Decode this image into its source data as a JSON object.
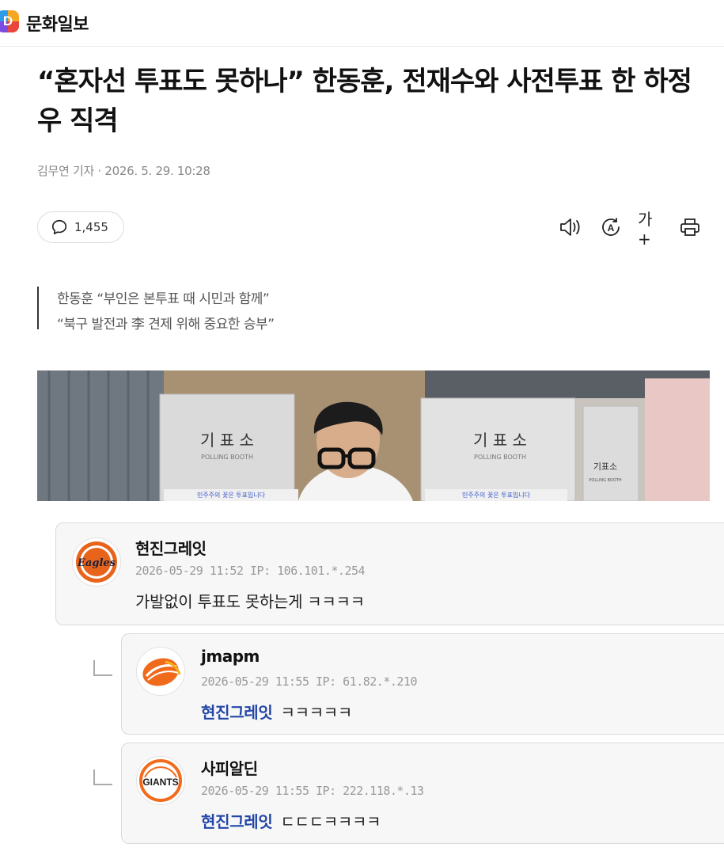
{
  "header": {
    "logo_letter": "D",
    "brand": "문화일보"
  },
  "article": {
    "title": "“혼자선 투표도 못하나” 한동훈, 전재수와 사전투표 한 하정우 직격",
    "byline": "김무연 기자 · 2026. 5. 29. 10:28",
    "comment_count": "1,455",
    "tools": {
      "font_size_label": "가+"
    },
    "summary": [
      "한동훈 “부인은 본투표 때 시민과 함께”",
      "“북구 발전과 李 견제 위해 중요한 승부”"
    ],
    "photo": {
      "booth_left": "기 표 소",
      "booth_left_sub": "POLLING BOOTH",
      "booth_right": "기 표 소",
      "booth_right_sub": "POLLING BOOTH",
      "booth_far": "기표소",
      "booth_far_sub": "POLLING BOOTH",
      "booth_strip_left": "민주주의 꽃은 투표입니다",
      "booth_strip_right": "민주주의 꽃은 투표입니다"
    }
  },
  "comments": [
    {
      "nickname": "현진그레잇",
      "meta": "2026-05-29 11:52  IP: 106.101.*.254",
      "mention": "",
      "text": "가발없이 투표도 못하는게 ㅋㅋㅋㅋ",
      "avatar_label": "Eagles"
    },
    {
      "nickname": "jmapm",
      "meta": "2026-05-29 11:55  IP: 61.82.*.210",
      "mention": "현진그레잇",
      "text": "ㅋㅋㅋㅋㅋ",
      "avatar_label": ""
    },
    {
      "nickname": "사피알딘",
      "meta": "2026-05-29 11:55  IP: 222.118.*.13",
      "mention": "현진그레잇",
      "text": "ㄷㄷㄷㅋㅋㅋㅋ",
      "avatar_label": "GIANTS"
    }
  ],
  "colors": {
    "mention": "#2346a8",
    "comment_bg": "#f7f7f7",
    "eagles_orange": "#e8641b",
    "giants_orange": "#f26b1d"
  }
}
